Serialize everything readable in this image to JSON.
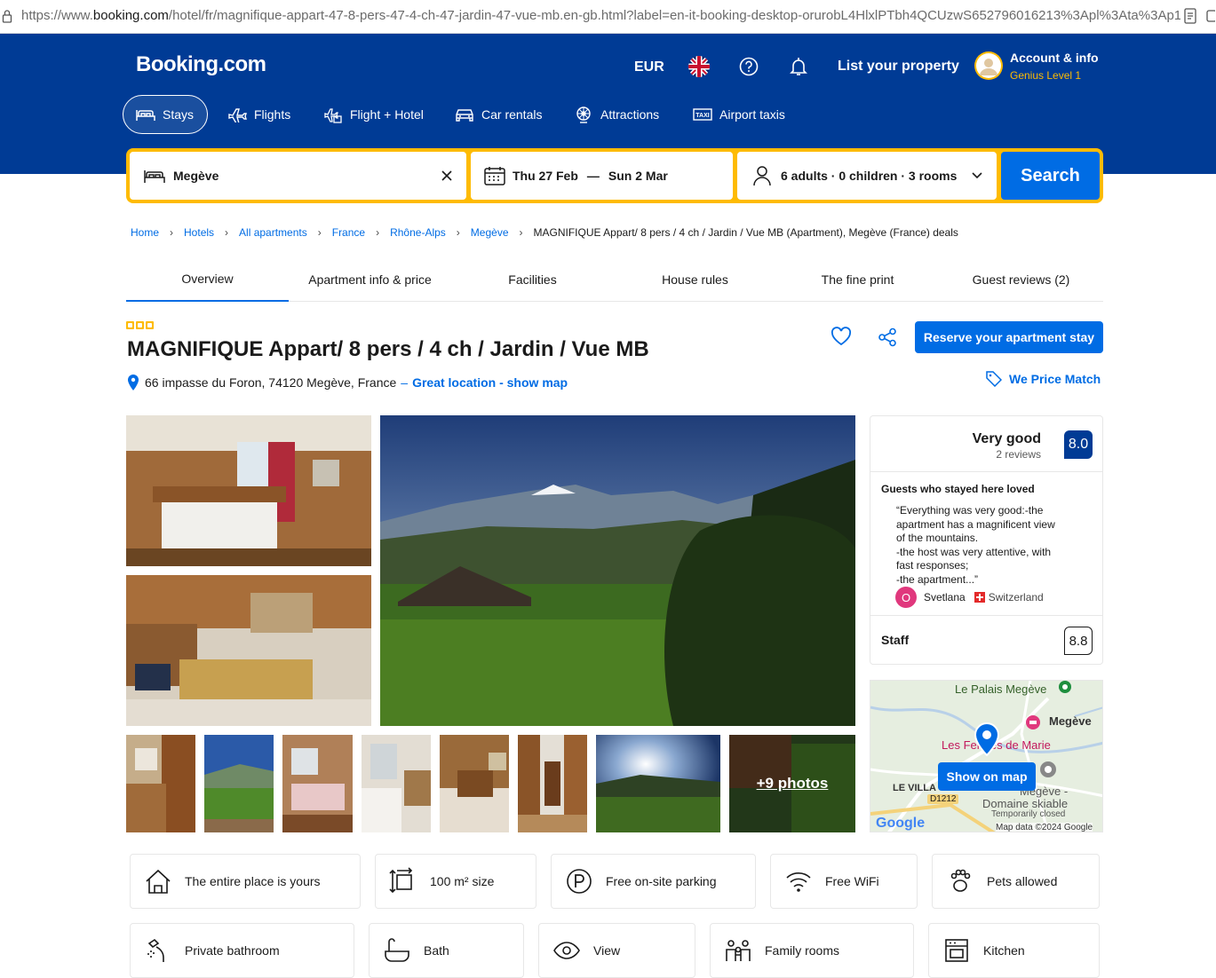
{
  "browser": {
    "url_prefix": "https://www.",
    "url_domain": "booking.com",
    "url_rest": "/hotel/fr/magnifique-appart-47-8-pers-47-4-ch-47-jardin-47-vue-mb.en-gb.html?label=en-it-booking-desktop-orurobL4HlxlPTbh4QCUzwS652796016213%3Apl%3Ata%3Ap1%"
  },
  "header": {
    "logo": "Booking.com",
    "currency": "EUR",
    "list_property": "List your property",
    "account_name": "Account & info",
    "genius_level": "Genius Level 1",
    "nav": [
      {
        "label": "Stays",
        "icon": "bed-icon",
        "active": true
      },
      {
        "label": "Flights",
        "icon": "plane-icon"
      },
      {
        "label": "Flight + Hotel",
        "icon": "flight-hotel-icon"
      },
      {
        "label": "Car rentals",
        "icon": "car-icon"
      },
      {
        "label": "Attractions",
        "icon": "attractions-icon"
      },
      {
        "label": "Airport taxis",
        "icon": "taxi-icon"
      }
    ]
  },
  "search": {
    "destination": "Megève",
    "checkin": "Thu 27 Feb",
    "dash": "—",
    "checkout": "Sun 2 Mar",
    "guests": "6 adults · 0 children · 3 rooms",
    "button": "Search"
  },
  "breadcrumbs": [
    "Home",
    "Hotels",
    "All apartments",
    "France",
    "Rhône-Alps",
    "Megève"
  ],
  "breadcrumb_current": "MAGNIFIQUE Appart/ 8 pers / 4 ch / Jardin / Vue MB (Apartment), Megève (France) deals",
  "tabs": [
    "Overview",
    "Apartment info & price",
    "Facilities",
    "House rules",
    "The fine print",
    "Guest reviews (2)"
  ],
  "property": {
    "stars": 3,
    "title": "MAGNIFIQUE Appart/ 8 pers / 4 ch / Jardin / Vue MB",
    "address": "66 impasse du Foron, 74120 Megève, France",
    "address_sep": "–",
    "location_link": "Great location - show map",
    "reserve_button": "Reserve your apartment stay",
    "price_match": "We Price Match"
  },
  "gallery": {
    "more_photos": "+9 photos"
  },
  "reviews": {
    "rating_word": "Very good",
    "review_count": "2 reviews",
    "score": "8.0",
    "loved_heading": "Guests who stayed here loved",
    "quote_lines": [
      "“Everything was very good:-the",
      "apartment has a magnificent view",
      "of the mountains.",
      "-the host was very attentive, with",
      "fast responses;",
      "-the apartment...”"
    ],
    "reviewer_initial": "O",
    "reviewer_name": "Svetlana",
    "reviewer_country": "Switzerland",
    "staff_label": "Staff",
    "staff_score": "8.8"
  },
  "map": {
    "labels": [
      "Le Palais Megève",
      "Megève",
      "Les Fermes de Marie",
      "LE VILLA",
      "D1212",
      "Megève -",
      "Domaine skiable",
      "Temporarily closed",
      "Map data ©2024 Google",
      "Google"
    ],
    "show_on_map": "Show on map"
  },
  "facilities": [
    {
      "label": "The entire place is yours",
      "icon": "house-icon"
    },
    {
      "label": "100 m² size",
      "icon": "size-icon"
    },
    {
      "label": "Free on-site parking",
      "icon": "parking-icon"
    },
    {
      "label": "Free WiFi",
      "icon": "wifi-icon"
    },
    {
      "label": "Pets allowed",
      "icon": "paw-icon"
    },
    {
      "label": "Private bathroom",
      "icon": "shower-icon"
    },
    {
      "label": "Bath",
      "icon": "bath-icon"
    },
    {
      "label": "View",
      "icon": "eye-icon"
    },
    {
      "label": "Family rooms",
      "icon": "family-icon"
    },
    {
      "label": "Kitchen",
      "icon": "kitchen-icon"
    }
  ],
  "colors": {
    "brand_blue": "#003b95",
    "action_blue": "#006ce4",
    "search_yellow": "#febb02"
  }
}
